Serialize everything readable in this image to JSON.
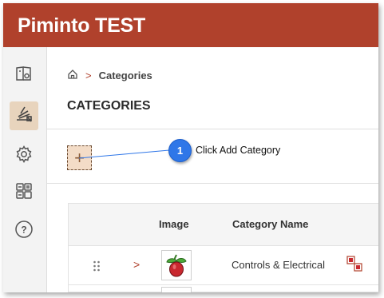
{
  "header": {
    "app_title": "Piminto TEST"
  },
  "sidebar": {
    "items": [
      {
        "icon": "book-icon",
        "active": false
      },
      {
        "icon": "category-icon",
        "active": true
      },
      {
        "icon": "gear-icon",
        "active": false
      },
      {
        "icon": "apps-grid-icon",
        "active": false
      },
      {
        "icon": "help-icon",
        "active": false,
        "glyph": "?"
      }
    ]
  },
  "breadcrumb": {
    "home_icon": "home-icon",
    "separator": ">",
    "current": "Categories"
  },
  "page": {
    "title": "CATEGORIES"
  },
  "toolbar": {
    "add_label": "+"
  },
  "callout": {
    "number": "1",
    "text": "Click Add Category",
    "color": "#2f77e8"
  },
  "table": {
    "columns": [
      "Image",
      "Category Name"
    ],
    "rows": [
      {
        "name": "Controls & Electrical",
        "expand_glyph": ">"
      }
    ]
  },
  "colors": {
    "brand": "#b0412c",
    "active_nav": "#e8d4bd",
    "add_button": "#f3dcc7"
  }
}
